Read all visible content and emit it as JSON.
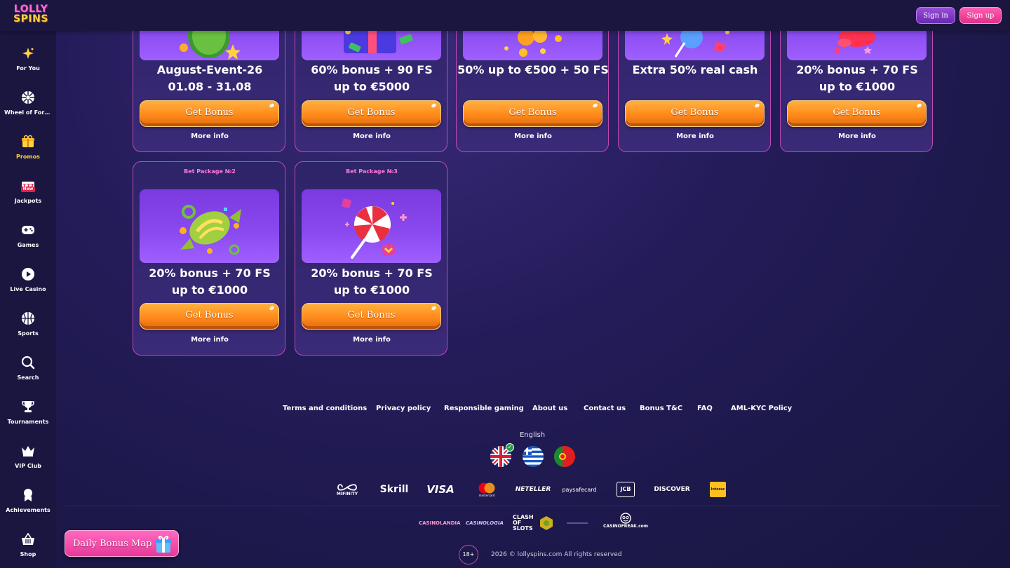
{
  "header": {
    "logo_line1": "LOLLY",
    "logo_line2": "SPINS",
    "signin_label": "Sign in",
    "signup_label": "Sign up"
  },
  "sidebar": {
    "items": [
      {
        "label": "For You",
        "icon": "sparkle-icon"
      },
      {
        "label": "Wheel of Fortune",
        "icon": "wheel-icon"
      },
      {
        "label": "Promos",
        "icon": "gift-icon"
      },
      {
        "label": "Jackpots",
        "icon": "slot-777-icon",
        "badge": "New"
      },
      {
        "label": "Games",
        "icon": "gamepad-icon"
      },
      {
        "label": "Live Casino",
        "icon": "play-icon"
      },
      {
        "label": "Sports",
        "icon": "basketball-icon"
      },
      {
        "label": "Search",
        "icon": "search-icon"
      },
      {
        "label": "Tournaments",
        "icon": "trophy-icon"
      },
      {
        "label": "VIP Club",
        "icon": "crown-icon"
      },
      {
        "label": "Achievements",
        "icon": "medal-icon"
      },
      {
        "label": "Shop",
        "icon": "basket-icon"
      }
    ]
  },
  "promos": {
    "top_row": [
      {
        "title_line1": "August-Event-26",
        "title_line2": "01.08 - 31.08",
        "button": "Get Bonus",
        "more": "More info"
      },
      {
        "title_line1": "60% bonus + 90 FS",
        "title_line2": "up to €5000",
        "button": "Get Bonus",
        "more": "More info"
      },
      {
        "title_line1": "50% up to €500 + 50 FS",
        "title_line2": "",
        "button": "Get Bonus",
        "more": "More info"
      },
      {
        "title_line1": "Extra 50% real cash",
        "title_line2": "",
        "button": "Get Bonus",
        "more": "More info"
      },
      {
        "title_line1": "20% bonus + 70 FS",
        "title_line2": "up to €1000",
        "button": "Get Bonus",
        "more": "More info"
      }
    ],
    "bottom_row": [
      {
        "category": "Bet Package №2",
        "title_line1": "20% bonus + 70 FS",
        "title_line2": "up to €1000",
        "button": "Get Bonus",
        "more": "More info"
      },
      {
        "category": "Bet Package №3",
        "title_line1": "20% bonus + 70 FS",
        "title_line2": "up to €1000",
        "button": "Get Bonus",
        "more": "More info"
      }
    ]
  },
  "footer": {
    "links": [
      "Terms and conditions",
      "Privacy policy",
      "Responsible gaming",
      "About us",
      "Contact us",
      "Bonus T&C",
      "FAQ",
      "AML-KYC Policy"
    ],
    "language": "English",
    "payments": [
      "MIFINITY",
      "Skrill",
      "VISA",
      "mastercard",
      "NETELLER",
      "paysafecard",
      "JCB",
      "DISCOVER",
      "Interac"
    ],
    "partners": [
      "CASINOLANDIA",
      "CASINOLOGIA",
      "CLASH OF SLOTS",
      "CASINOFREAK.com"
    ],
    "age": "18+",
    "copyright": "2026 © lollyspins.com All rights reserved"
  },
  "daily_bonus": {
    "label": "Daily Bonus Map"
  },
  "colors": {
    "accent_orange": "#ff8a1a",
    "accent_pink": "#e8389a",
    "card_border": "#c04ab0",
    "background": "#1e1a4a"
  }
}
